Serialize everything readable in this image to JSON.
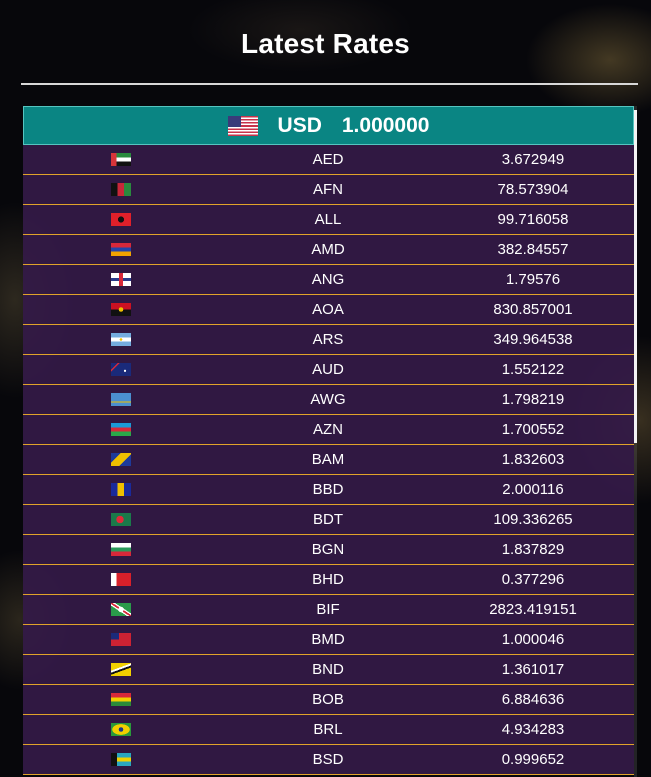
{
  "page": {
    "title": "Latest Rates"
  },
  "base": {
    "flag_icon": "us-flag-icon",
    "code": "USD",
    "rate": "1.000000"
  },
  "colors": {
    "base_row": "#0a8583",
    "row_bg": "#341a48",
    "row_border": "#e0a32a",
    "text": "#ffffff"
  },
  "rates": [
    {
      "code": "AED",
      "rate": "3.672949",
      "flag_icon": "ae-flag-icon",
      "flag_css": "linear-gradient(to right,#d8343a 0 28%,transparent 28%),linear-gradient(to bottom,#2a8a3e 0 33%,#ffffff 33% 66%,#111111 66%)"
    },
    {
      "code": "AFN",
      "rate": "78.573904",
      "flag_icon": "af-flag-icon",
      "flag_css": "linear-gradient(to right,#111111 0 33%,#c8283a 33% 66%,#2a8a3e 66%)"
    },
    {
      "code": "ALL",
      "rate": "99.716058",
      "flag_icon": "al-flag-icon",
      "flag_css": "radial-gradient(circle at 50% 50%,#111111 0 25%,transparent 26%),#e0202a"
    },
    {
      "code": "AMD",
      "rate": "382.84557",
      "flag_icon": "am-flag-icon",
      "flag_css": "linear-gradient(to bottom,#d8283a 0 33%,#2244aa 33% 66%,#f2a300 66%)"
    },
    {
      "code": "ANG",
      "rate": "1.79576",
      "flag_icon": "an-flag-icon",
      "flag_css": "linear-gradient(to right,transparent 0 40%,#d8283a 40% 60%,transparent 60%),linear-gradient(to bottom,#ffffff 0 40%,#2a3a8a 40% 60%,#ffffff 60%)"
    },
    {
      "code": "AOA",
      "rate": "830.857001",
      "flag_icon": "ao-flag-icon",
      "flag_css": "radial-gradient(circle at 50% 50%,#f0c000 0 18%,transparent 20%),linear-gradient(to bottom,#cc1122 0 50%,#111111 50%)"
    },
    {
      "code": "ARS",
      "rate": "349.964538",
      "flag_icon": "ar-flag-icon",
      "flag_css": "radial-gradient(circle at 50% 50%,#f0c000 0 10%,transparent 12%),linear-gradient(to bottom,#74acdf 0 33%,#ffffff 33% 66%,#74acdf 66%)"
    },
    {
      "code": "AUD",
      "rate": "1.552122",
      "flag_icon": "au-flag-icon",
      "flag_css": "radial-gradient(circle at 70% 60%,#ffffff 0 6%,transparent 8%),linear-gradient(to bottom,transparent 0 40%,transparent 40%),linear-gradient(135deg,transparent 0 20%,#d8283a 20% 26%,transparent 26%),#1a2a7a"
    },
    {
      "code": "AWG",
      "rate": "1.798219",
      "flag_icon": "aw-flag-icon",
      "flag_css": "linear-gradient(to bottom,transparent 0 66%,#f0c000 66% 74%,transparent 74%),#4b90d0"
    },
    {
      "code": "AZN",
      "rate": "1.700552",
      "flag_icon": "az-flag-icon",
      "flag_css": "linear-gradient(to bottom,#1a9ad8 0 33%,#d8283a 33% 66%,#2aa84a 66%)"
    },
    {
      "code": "BAM",
      "rate": "1.832603",
      "flag_icon": "ba-flag-icon",
      "flag_css": "linear-gradient(135deg,transparent 0 30%,#f0c000 30% 65%,transparent 65%),#1e3a9a"
    },
    {
      "code": "BBD",
      "rate": "2.000116",
      "flag_icon": "bb-flag-icon",
      "flag_css": "linear-gradient(to right,#1a2a9a 0 33%,#f0c000 33% 66%,#1a2a9a 66%)"
    },
    {
      "code": "BDT",
      "rate": "109.336265",
      "flag_icon": "bd-flag-icon",
      "flag_css": "radial-gradient(circle at 45% 50%,#e02a3a 0 28%,transparent 30%),#1a7a4a"
    },
    {
      "code": "BGN",
      "rate": "1.837829",
      "flag_icon": "bg-flag-icon",
      "flag_css": "linear-gradient(to bottom,#ffffff 0 33%,#2a9a5a 33% 66%,#d8283a 66%)"
    },
    {
      "code": "BHD",
      "rate": "0.377296",
      "flag_icon": "bh-flag-icon",
      "flag_css": "linear-gradient(to right,#ffffff 0 28%,#d8202a 28%)"
    },
    {
      "code": "BIF",
      "rate": "2823.419151",
      "flag_icon": "bi-flag-icon",
      "flag_css": "radial-gradient(circle at 50% 50%,#ffffff 0 22%,transparent 24%),linear-gradient(33deg,#2a9a4a 0 40%,#ffffff 40% 46%,#d8283a 46% 54%,#ffffff 54% 60%,#2a9a4a 60%)"
    },
    {
      "code": "BMD",
      "rate": "1.000046",
      "flag_icon": "bm-flag-icon",
      "flag_css": "linear-gradient(to right,#1a2a7a 0 40%,transparent 40%) 0 0/100% 50% no-repeat,#cc2233"
    },
    {
      "code": "BND",
      "rate": "1.361017",
      "flag_icon": "bn-flag-icon",
      "flag_css": "linear-gradient(160deg,#f2d000 0 38%,#ffffff 38% 48%,#111111 48% 58%,#f2d000 58%)"
    },
    {
      "code": "BOB",
      "rate": "6.884636",
      "flag_icon": "bo-flag-icon",
      "flag_css": "linear-gradient(to bottom,#d8283a 0 33%,#f2d000 33% 66%,#2a8a3a 66%)"
    },
    {
      "code": "BRL",
      "rate": "4.934283",
      "flag_icon": "br-flag-icon",
      "flag_css": "radial-gradient(circle at 50% 50%,#1a3a8a 0 18%,transparent 20%),radial-gradient(ellipse 45% 42% at 50% 50%,#f2d000 0 95%,transparent 100%),#2a9a3a"
    },
    {
      "code": "BSD",
      "rate": "0.999652",
      "flag_icon": "bs-flag-icon",
      "flag_css": "linear-gradient(to right,#111111 0 30%,transparent 30%),linear-gradient(to bottom,#2aa6c0 0 33%,#f2d000 33% 66%,#2aa6c0 66%)"
    }
  ]
}
